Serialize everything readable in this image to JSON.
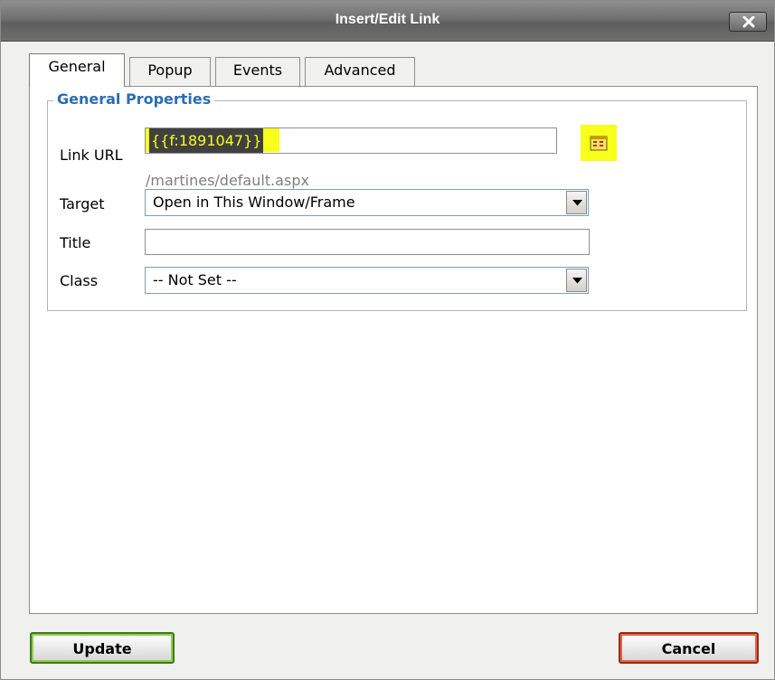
{
  "window": {
    "title": "Insert/Edit Link"
  },
  "tabs": [
    {
      "label": "General",
      "active": true
    },
    {
      "label": "Popup",
      "active": false
    },
    {
      "label": "Events",
      "active": false
    },
    {
      "label": "Advanced",
      "active": false
    }
  ],
  "general_properties": {
    "legend": "General Properties",
    "link_url": {
      "label": "Link URL",
      "value": "{{f:1891047}}",
      "hint": "/martines/default.aspx"
    },
    "target": {
      "label": "Target",
      "selected": "Open in This Window/Frame"
    },
    "title": {
      "label": "Title",
      "value": ""
    },
    "class": {
      "label": "Class",
      "selected": "-- Not Set --"
    }
  },
  "buttons": {
    "update": "Update",
    "cancel": "Cancel"
  },
  "icons": {
    "close": "close-icon",
    "browse": "browse-icon",
    "dropdown": "chevron-down-icon"
  },
  "colors": {
    "highlight": "#f8ff1a",
    "legend": "#2b6cb3",
    "update_border": "#3c7b1b",
    "cancel_border": "#9c2a12"
  }
}
